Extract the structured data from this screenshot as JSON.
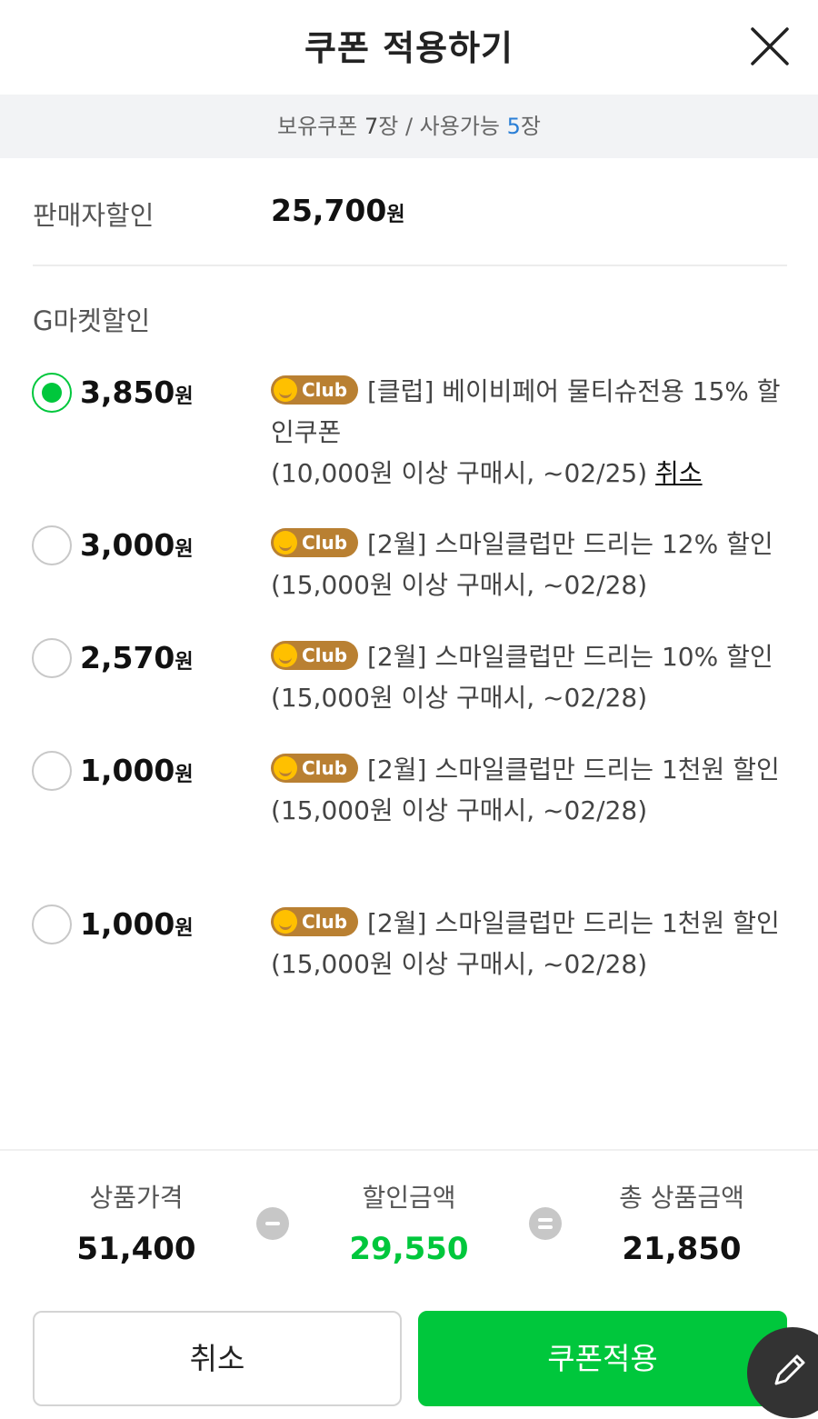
{
  "header": {
    "title": "쿠폰 적용하기"
  },
  "summary": {
    "owned_label": "보유쿠폰 ",
    "owned_count": "7",
    "unit": "장",
    "separator": " / ",
    "available_label": "사용가능 ",
    "available_count": "5"
  },
  "seller_discount": {
    "label": "판매자할인",
    "amount": "25,700",
    "unit": "원"
  },
  "gmarket_discount": {
    "label": "G마켓할인"
  },
  "coupons": [
    {
      "amount": "3,850",
      "unit": "원",
      "selected": true,
      "badge": "Club",
      "title": "[클럽] 베이비페어 물티슈전용 15% 할인쿠폰",
      "condition": "(10,000원 이상 구매시, ~02/25)",
      "cancel_label": "취소"
    },
    {
      "amount": "3,000",
      "unit": "원",
      "selected": false,
      "badge": "Club",
      "title": "[2월] 스마일클럽만 드리는 12% 할인",
      "condition": "(15,000원 이상 구매시, ~02/28)"
    },
    {
      "amount": "2,570",
      "unit": "원",
      "selected": false,
      "badge": "Club",
      "title": "[2월] 스마일클럽만 드리는 10% 할인",
      "condition": "(15,000원 이상 구매시, ~02/28)"
    },
    {
      "amount": "1,000",
      "unit": "원",
      "selected": false,
      "badge": "Club",
      "title": "[2월] 스마일클럽만 드리는 1천원 할인",
      "condition": "(15,000원 이상 구매시, ~02/28)"
    },
    {
      "amount": "1,000",
      "unit": "원",
      "selected": false,
      "badge": "Club",
      "title": "[2월] 스마일클럽만 드리는 1천원 할인",
      "condition": "(15,000원 이상 구매시, ~02/28)"
    }
  ],
  "totals": {
    "price_label": "상품가격",
    "price_value": "51,400",
    "discount_label": "할인금액",
    "discount_value": "29,550",
    "total_label": "총 상품금액",
    "total_value": "21,850"
  },
  "buttons": {
    "cancel": "취소",
    "apply": "쿠폰적용"
  },
  "colors": {
    "accent_green": "#00c73c",
    "available_blue": "#2b7fd6",
    "club_badge": "#b98032"
  },
  "icons": {
    "close": "close-icon",
    "minus": "minus-circle-icon",
    "equals": "equals-circle-icon",
    "fab": "pencil-icon"
  }
}
